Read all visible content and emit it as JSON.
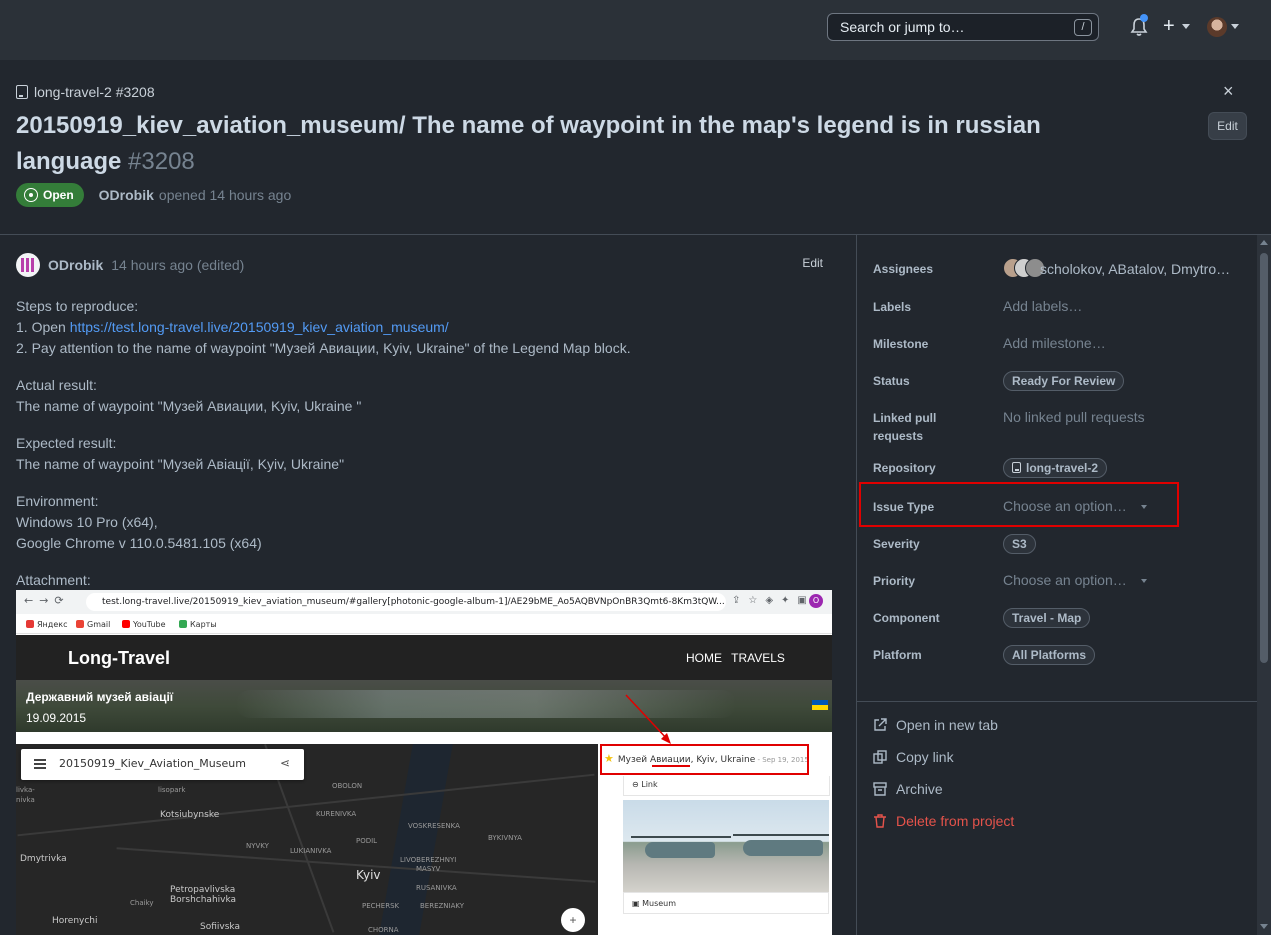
{
  "header": {
    "search_placeholder": "Search or jump to…",
    "search_shortcut": "/",
    "plus_label": "+"
  },
  "issue": {
    "repo_ref": "long-travel-2 #3208",
    "title": "20150919_kiev_aviation_museum/ The name of waypoint in the map's legend is in russian language",
    "number": "#3208",
    "status": "Open",
    "author": "ODrobik",
    "opened_text": "opened 14 hours ago",
    "edit_label": "Edit",
    "close_label": "×"
  },
  "comment": {
    "author": "ODrobik",
    "time": "14 hours ago (edited)",
    "edit_label": "Edit",
    "steps_heading": "Steps to reproduce:",
    "step1_prefix": "1. Open ",
    "step1_link": "https://test.long-travel.live/20150919_kiev_aviation_museum/",
    "step2": "2. Pay attention to the name of waypoint \"Музей Авиации, Kyiv, Ukraine\" of the Legend Map block.",
    "actual_heading": "Actual result:",
    "actual_text": "The name of waypoint \"Музей Авиации, Kyiv, Ukraine \"",
    "expected_heading": "Expected result:",
    "expected_text": "The name of waypoint \"Музей Авіації, Kyiv, Ukraine\"",
    "env_heading": "Environment:",
    "env_os": "Windows 10 Pro (x64),",
    "env_browser": "Google Chrome v 110.0.5481.105 (x64)",
    "attachment_heading": "Attachment:"
  },
  "screenshot": {
    "url": "test.long-travel.live/20150919_kiev_aviation_museum/#gallery[photonic-google-album-1]/AE29bME_Ao5AQBVNpOnBR3Qmt6-8Km3tQW...",
    "profile_letter": "O",
    "bookmarks": [
      "Яндекс",
      "Gmail",
      "YouTube",
      "Карты"
    ],
    "site_logo": "Long-Travel",
    "site_nav": "HOME TRAVELS",
    "hero_title": "Державний музей авіації",
    "hero_date": "19.09.2015",
    "map_name": "20150919_Kiev_Aviation_Museum",
    "map_labels": {
      "kivka": "livka-",
      "nivka": "nivka",
      "lisopark": "lisopark",
      "obolon": "OBOLON",
      "kotsiubynske": "Kotsiubynske",
      "kurenivka": "KURENIVKA",
      "voskresenka": "VOSKRESENKA",
      "bykivnya": "BYKIVNYA",
      "nyvky": "NYVKY",
      "lukianivka": "LUKIANIVKA",
      "podil": "PODIL",
      "dmytrivka": "Dmytrivka",
      "kyiv": "Kyiv",
      "livoberezhnyi": "LIVOBEREZHNYI",
      "masyv": "MASYV",
      "rusanivka": "RUSANIVKA",
      "petropavlivska": "Petropavlivska",
      "borshchahivka": "Borshchahivka",
      "chaiky": "Chaiky",
      "pechersk": "PECHERSK",
      "berezniaky": "BEREZNIAKY",
      "horenychi": "Horenychi",
      "sofiivska": "Sofiivska",
      "khorna": "CHORNA"
    },
    "zoom_label": "+",
    "legend_entry": "Музей Авиации, Kyiv, Ukraine",
    "legend_date": " - Sep 19, 2015",
    "legend_link": "Link",
    "legend_photo_label": "Museum"
  },
  "sidebar": {
    "assignees_label": "Assignees",
    "assignees_value": "scholokov, ABatalov, Dmytro…",
    "labels_label": "Labels",
    "labels_value": "Add labels…",
    "milestone_label": "Milestone",
    "milestone_value": "Add milestone…",
    "status_label": "Status",
    "status_value": "Ready For Review",
    "linked_label": "Linked pull requests",
    "linked_value": "No linked pull requests",
    "repository_label": "Repository",
    "repository_value": "long-travel-2",
    "issue_type_label": "Issue Type",
    "issue_type_value": "Choose an option…",
    "severity_label": "Severity",
    "severity_value": "S3",
    "priority_label": "Priority",
    "priority_value": "Choose an option…",
    "component_label": "Component",
    "component_value": "Travel - Map",
    "platform_label": "Platform",
    "platform_value": "All Platforms",
    "actions": {
      "open_new_tab": "Open in new tab",
      "copy_link": "Copy link",
      "archive": "Archive",
      "delete": "Delete from project"
    }
  },
  "colors": {
    "accent_link": "#539bf5",
    "open_badge": "#347d39",
    "danger": "#e5534b",
    "annotation_red": "#e00000"
  }
}
